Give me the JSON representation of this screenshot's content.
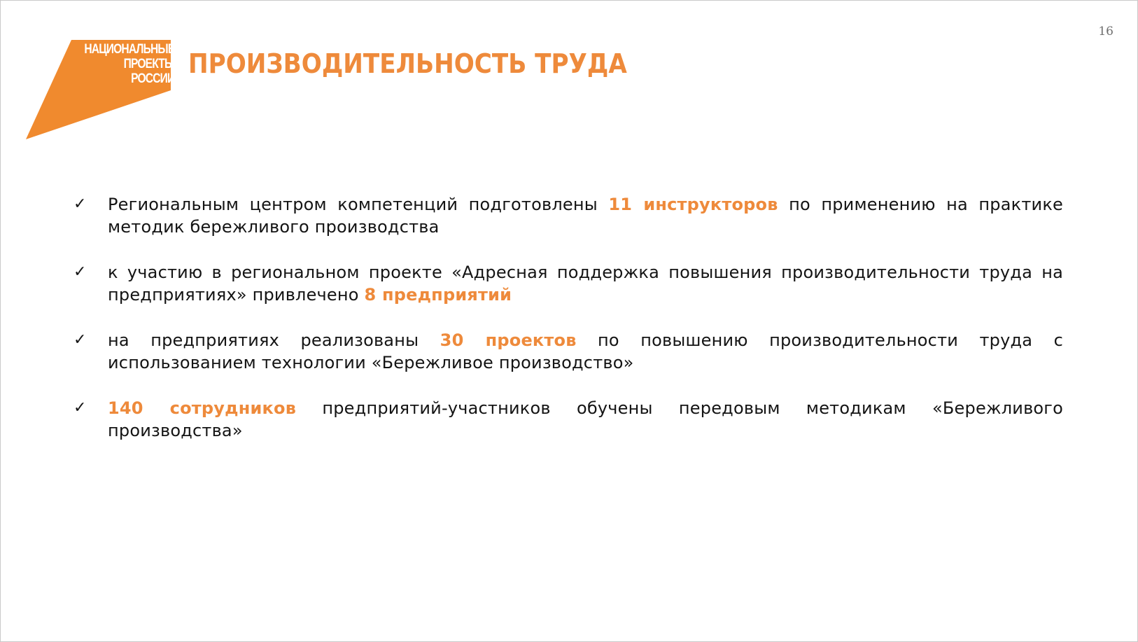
{
  "page_number": "16",
  "logo": {
    "lines": [
      "НАЦИОНАЛЬНЫЕ",
      "ПРОЕКТЫ",
      "РОССИИ"
    ],
    "color": "#f08a2e"
  },
  "title": "ПРОИЗВОДИТЕЛЬНОСТЬ ТРУДА",
  "accent_color": "#ee8a3b",
  "bullets": [
    {
      "check_icon": "✓",
      "before": "Региональным центром компетенций подготовлены ",
      "highlight": "11 инструкторов",
      "after": " по применению на практике методик бережливого производства"
    },
    {
      "check_icon": "✓",
      "before": "к участию в региональном проекте «Адресная поддержка повышения производительности труда на предприятиях» привлечено ",
      "highlight": "8 предприятий",
      "after": ""
    },
    {
      "check_icon": "✓",
      "before": "на предприятиях реализованы ",
      "highlight": "30 проектов",
      "after": " по повышению производительности труда с использованием технологии «Бережливое производство»"
    },
    {
      "check_icon": "✓",
      "before": "",
      "highlight": "140 сотрудников",
      "after": " предприятий-участников обучены передовым методикам «Бережливого производства»"
    }
  ]
}
